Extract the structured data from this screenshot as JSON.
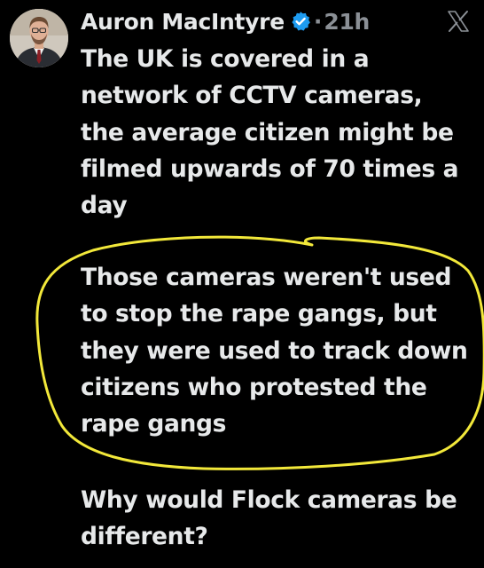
{
  "tweet": {
    "author_name": "Auron MacIntyre",
    "separator": "·",
    "timestamp": "21h",
    "paragraphs": [
      {
        "lines": [
          "The UK is covered in a",
          "network of CCTV cameras,",
          "the average citizen might be",
          "filmed upwards of 70 times a",
          "day"
        ]
      },
      {
        "lines": [
          "Those cameras weren't used",
          "to stop the rape gangs, but",
          "they were used to track down",
          "citizens who protested the",
          "rape gangs"
        ]
      },
      {
        "lines": [
          "Why would Flock cameras be",
          "different?"
        ]
      }
    ]
  },
  "icons": {
    "verified": "verified-badge-icon",
    "platform": "x-logo-icon",
    "avatar": "profile-photo"
  },
  "colors": {
    "background": "#000000",
    "text": "#e7e9ea",
    "muted": "#8b9096",
    "verified": "#1d9bf0",
    "annotation": "#f2e83a"
  }
}
